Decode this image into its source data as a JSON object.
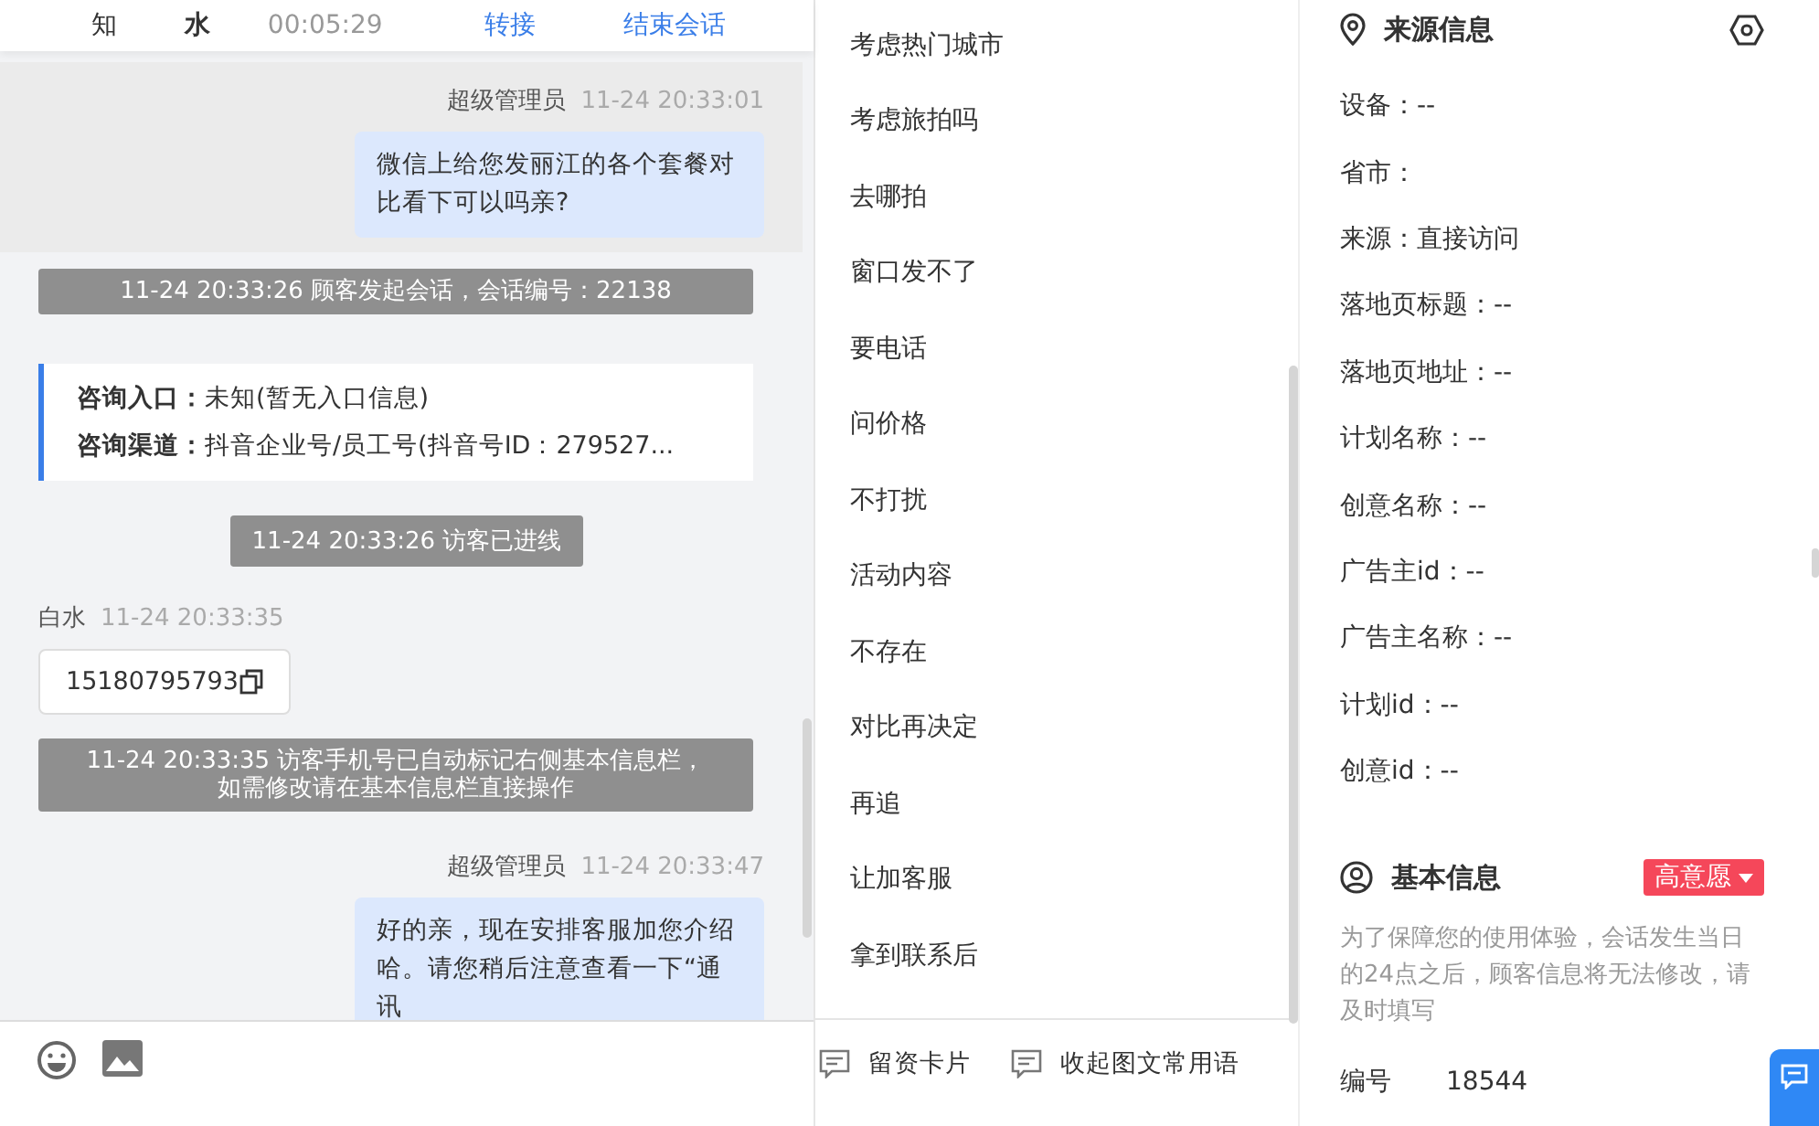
{
  "chat_header": {
    "name_1": "知",
    "name_2": "水",
    "duration": "00:05:29",
    "actions": [
      "转接",
      "结束会话"
    ]
  },
  "messages": [
    {
      "kind": "agent",
      "sender": "超级管理员",
      "time": "11-24 20:33:01",
      "text": "微信上给您发丽江的各个套餐对比看下可以吗亲?",
      "highlighted": true
    },
    {
      "kind": "system",
      "text": "11-24 20:33:26 顾客发起会话，会话编号：22138"
    },
    {
      "kind": "entry",
      "rows": [
        {
          "label": "咨询入口：",
          "value": "未知(暂无入口信息)"
        },
        {
          "label": "咨询渠道：",
          "value": "抖音企业号/员工号(抖音号ID：279527..."
        }
      ]
    },
    {
      "kind": "system",
      "text": "11-24 20:33:26 访客已进线"
    },
    {
      "kind": "visitor",
      "sender": "白水",
      "time": "11-24 20:33:35",
      "text": "15180795793"
    },
    {
      "kind": "system",
      "text": "11-24 20:33:35 访客手机号已自动标记右侧基本信息栏，如需修改请在基本信息栏直接操作"
    },
    {
      "kind": "agent",
      "sender": "超级管理员",
      "time": "11-24 20:33:47",
      "text": "好的亲，现在安排客服加您介绍哈。请您稍后注意查看一下“通讯",
      "highlighted": false
    }
  ],
  "quick_phrases": [
    "考虑热门城市",
    "考虑旅拍吗",
    "去哪拍",
    "窗口发不了",
    "要电话",
    "问价格",
    "不打扰",
    "活动内容",
    "不存在",
    "对比再决定",
    "再追",
    "让加客服",
    "拿到联系后"
  ],
  "phrase_actions": [
    "留资卡片",
    "收起图文常用语"
  ],
  "source_info": {
    "title": "来源信息",
    "fields": [
      "设备：--",
      "省市：",
      "来源：直接访问",
      "落地页标题：--",
      "落地页地址：--",
      "计划名称：--",
      "创意名称：--",
      "广告主id：--",
      "广告主名称：--",
      "计划id：--",
      "创意id：--"
    ]
  },
  "basic_info": {
    "title": "基本信息",
    "intent_tag": "高意愿",
    "note": "为了保障您的使用体验，会话发生当日的24点之后，顾客信息将无法修改，请及时填写",
    "id_label": "编号",
    "id_value": "18544"
  }
}
